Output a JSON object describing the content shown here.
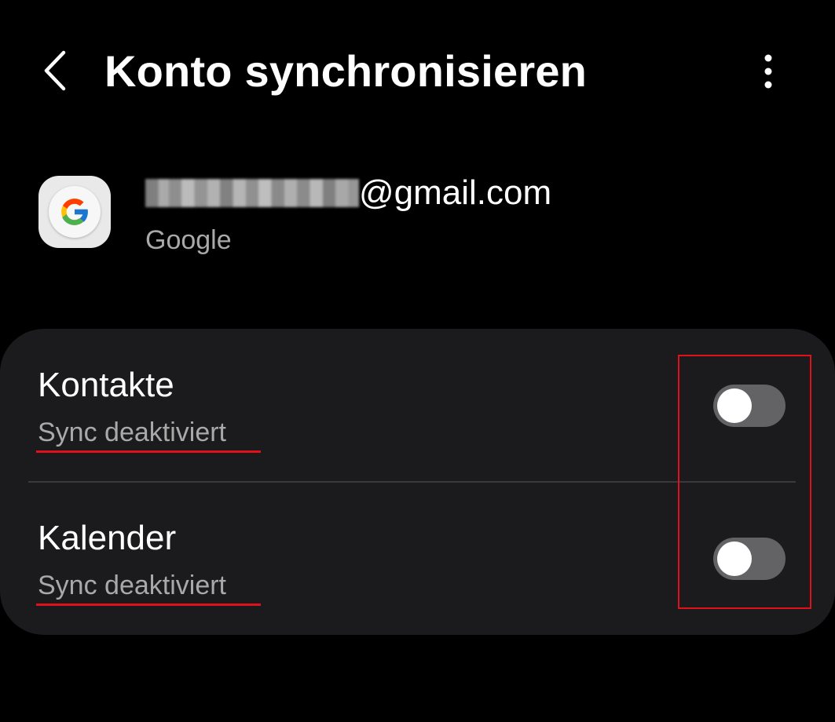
{
  "header": {
    "title": "Konto synchronisieren",
    "back_icon": "chevron-left-icon",
    "more_icon": "more-vertical-icon"
  },
  "account": {
    "icon": "google-g-icon",
    "email_domain": "@gmail.com",
    "type": "Google"
  },
  "sync_items": [
    {
      "label": "Kontakte",
      "status": "Sync deaktiviert",
      "enabled": false
    },
    {
      "label": "Kalender",
      "status": "Sync deaktiviert",
      "enabled": false
    }
  ],
  "colors": {
    "background": "#000000",
    "card": "#1b1b1d",
    "toggle_off": "#636366",
    "annotation_red": "#e0111b",
    "secondary_text": "#a9a9a9"
  }
}
